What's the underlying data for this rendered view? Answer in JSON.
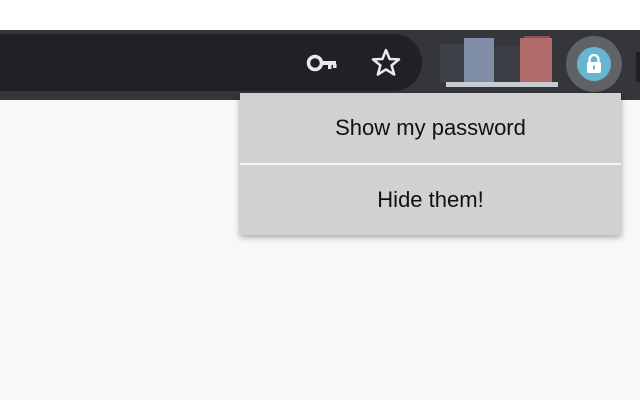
{
  "toolbar": {
    "icons": [
      "key-icon",
      "star-icon",
      "lock-icon"
    ]
  },
  "popup": {
    "items": [
      {
        "label": "Show my password"
      },
      {
        "label": "Hide them!"
      }
    ]
  },
  "colors": {
    "toolbar": "#35363a",
    "omnibox": "#202124",
    "popup": "#d1d1d1",
    "extension_accent": "#67b6d1",
    "page_background": "#f8f8f8"
  }
}
